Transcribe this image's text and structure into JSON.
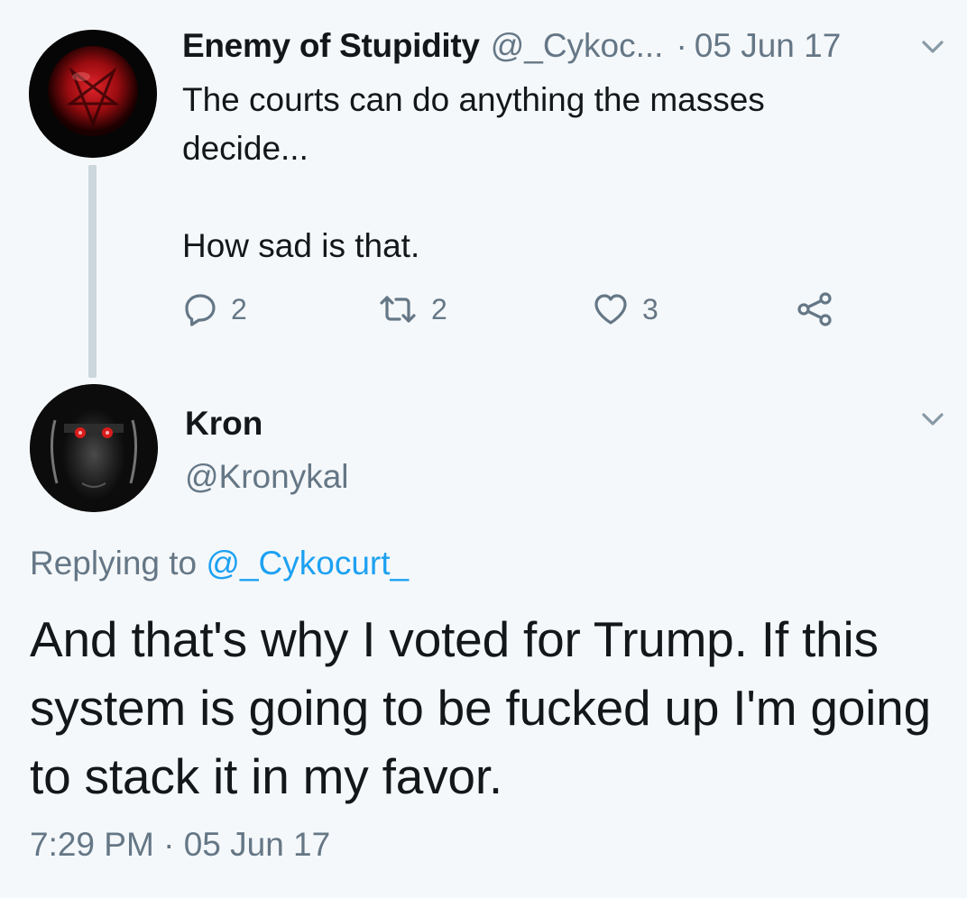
{
  "parent_tweet": {
    "display_name": "Enemy of Stupidity",
    "handle": "@_Cykoc...",
    "separator": "·",
    "date": "05 Jun 17",
    "text": "The courts can do anything the masses\ndecide...\n\nHow sad is that.",
    "actions": {
      "reply_count": "2",
      "retweet_count": "2",
      "like_count": "3"
    }
  },
  "reply_tweet": {
    "display_name": "Kron",
    "handle": "@Kronykal",
    "replying_to_label": "Replying to",
    "replying_to_handle": "@_Cykocurt_",
    "text": "And that's why I voted for Trump. If this system is going to be fucked up I'm going to stack it in my favor.",
    "time": "7:29 PM",
    "separator": "·",
    "date": "05 Jun 17"
  },
  "icons": {
    "reply": "reply-icon",
    "retweet": "retweet-icon",
    "like": "heart-icon",
    "share": "share-icon",
    "menu": "chevron-down-icon"
  },
  "colors": {
    "background": "#f5f8fa",
    "text": "#14171a",
    "secondary": "#657786",
    "link": "#1da1f2",
    "thread_line": "#ccd6dd"
  }
}
